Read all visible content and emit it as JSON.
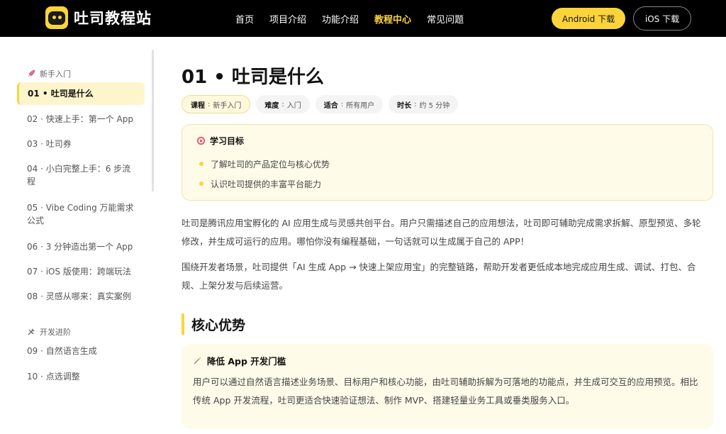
{
  "header": {
    "brand": "吐司教程站",
    "nav": [
      "首页",
      "项目介绍",
      "功能介绍",
      "教程中心",
      "常见问题"
    ],
    "active_nav": "教程中心",
    "android_btn": "Android 下载",
    "ios_btn": "iOS 下载"
  },
  "sidebar": {
    "sections": [
      {
        "title": "新手入门",
        "icon": "rocket-icon",
        "items": [
          "01 • 吐司是什么",
          "02 · 快速上手：第一个 App",
          "03 · 吐司券",
          "04 · 小白完整上手：6 步流程",
          "05 · Vibe Coding 万能需求公式",
          "06 · 3 分钟造出第一个 App",
          "07 · iOS 版使用：跨端玩法",
          "08 · 灵感从哪来：真实案例"
        ]
      },
      {
        "title": "开发进阶",
        "icon": "tools-icon",
        "items": [
          "09 · 自然语言生成",
          "10 · 点选调整"
        ]
      }
    ],
    "active_item": "01 • 吐司是什么"
  },
  "main": {
    "title": "01 • 吐司是什么",
    "meta": [
      {
        "key": "课程",
        "value": "新手入门"
      },
      {
        "key": "难度",
        "value": "入门"
      },
      {
        "key": "适合",
        "value": "所有用户"
      },
      {
        "key": "时长",
        "value": "约 5 分钟"
      }
    ],
    "goal_title": "学习目标",
    "goals": [
      "了解吐司的产品定位与核心优势",
      "认识吐司提供的丰富平台能力"
    ],
    "paragraph1": "吐司是腾讯应用宝孵化的 AI 应用生成与灵感共创平台。用户只需描述自己的应用想法，吐司即可辅助完成需求拆解、原型预览、多轮修改，并生成可运行的应用。哪怕你没有编程基础，一句话就可以生成属于自己的 APP！",
    "paragraph2": "围绕开发者场景，吐司提供「AI 生成 App → 快速上架应用宝」的完整链路，帮助开发者更低成本地完成应用生成、调试、打包、合规、上架分发与后续运营。",
    "section_title": "核心优势",
    "card_title": "降低 App 开发门槛",
    "card_body": "用户可以通过自然语言描述业务场景、目标用户和核心功能，由吐司辅助拆解为可落地的功能点，并生成可交互的应用预览。相比传统 App 开发流程，吐司更适合快速验证想法、制作 MVP、搭建轻量业务工具或垂类服务入口。"
  },
  "colors": {
    "accent": "#fbd43c",
    "header_bg": "#000000",
    "card_bg": "#fffbe9"
  }
}
